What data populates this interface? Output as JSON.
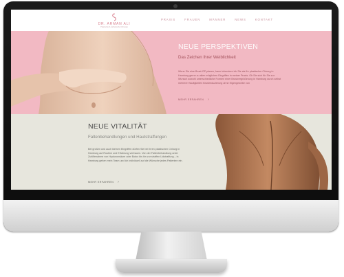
{
  "site": {
    "logo": {
      "name": "DR. ARMAN ALI",
      "subtitle": "Plastische & Ästhetische Chirurgie"
    },
    "nav": [
      "PRAXIS",
      "FRAUEN",
      "MÄNNER",
      "NEWS",
      "KONTAKT"
    ]
  },
  "section1": {
    "title": "NEUE PERSPEKTIVEN",
    "subtitle": "Das Zeichen Ihrer Weiblichkeit",
    "body": "Wenn Sie eine Brust-OP planen, kann informiere ich Sie als Ihr plastischer Chirurg in Hamburg gerne zu allen möglichen Eingriffen in meiner Praxis. Ob Sie sich für Sie zur Wunsch sowohl unterschiedliche Formen einer Brustvergrößerung in Hamburg durch selbst mehrere Haufigkeiten Brustreduzierung ohne Eigengewebe von",
    "link": "MEHR ERFAHREN",
    "link_icon": "chevron-right-icon"
  },
  "section2": {
    "title": "NEUE VITALITÄT",
    "subtitle": "Faltenbehandlungen und Hautstraffungen",
    "body": "Bei großen und auch kleinen Eingriffen dürfen Sie bei Ihren plastischen Chirurg in Hamburg auf Routine und Erfahrung vertrauen. Von der Faltenbehandlung unter Zuhilfenahme von Hyaluronsäure oder Botox bis hin zur straffen Lidstraffung – in Hamburg gehen mein Team und ich individuell auf die Wünsche jedes Patienten ein.",
    "link": "MEHR ERFAHREN",
    "link_icon": "chevron-right-icon"
  },
  "colors": {
    "pink": "#f2b9c3",
    "beige": "#e7e6dd",
    "accent": "#c98f9b"
  }
}
